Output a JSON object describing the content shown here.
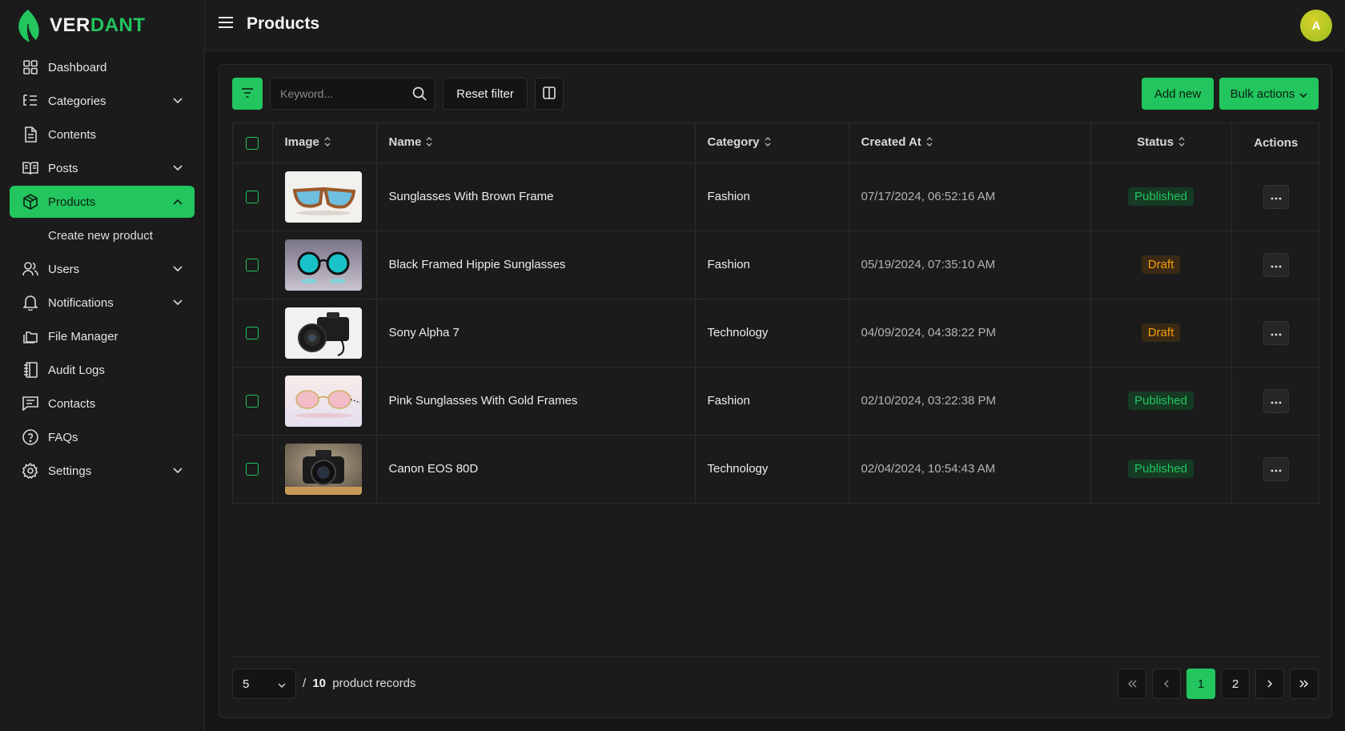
{
  "brand": {
    "part1": "VER",
    "part2": "DANT"
  },
  "header": {
    "title": "Products",
    "avatar_initial": "A"
  },
  "sidebar": {
    "items": [
      {
        "label": "Dashboard",
        "icon": "grid-icon",
        "chevron": ""
      },
      {
        "label": "Categories",
        "icon": "list-tree-icon",
        "chevron": "down"
      },
      {
        "label": "Contents",
        "icon": "document-icon",
        "chevron": ""
      },
      {
        "label": "Posts",
        "icon": "book-open-icon",
        "chevron": "down"
      },
      {
        "label": "Products",
        "icon": "box-icon",
        "chevron": "up",
        "active": true
      },
      {
        "label": "Users",
        "icon": "users-icon",
        "chevron": "down"
      },
      {
        "label": "Notifications",
        "icon": "bell-icon",
        "chevron": "down"
      },
      {
        "label": "File Manager",
        "icon": "folders-icon",
        "chevron": ""
      },
      {
        "label": "Audit Logs",
        "icon": "logs-icon",
        "chevron": ""
      },
      {
        "label": "Contacts",
        "icon": "message-icon",
        "chevron": ""
      },
      {
        "label": "FAQs",
        "icon": "help-circle-icon",
        "chevron": ""
      },
      {
        "label": "Settings",
        "icon": "gear-icon",
        "chevron": "down"
      }
    ],
    "products_sub": "Create new product"
  },
  "toolbar": {
    "search_placeholder": "Keyword...",
    "reset_label": "Reset filter",
    "add_label": "Add new",
    "bulk_label": "Bulk actions"
  },
  "table": {
    "headers": [
      "Image",
      "Name",
      "Category",
      "Created At",
      "Status",
      "Actions"
    ],
    "rows": [
      {
        "name": "Sunglasses With Brown Frame",
        "category": "Fashion",
        "created": "07/17/2024, 06:52:16 AM",
        "status": "Published",
        "image": "sunglasses-brown"
      },
      {
        "name": "Black Framed Hippie Sunglasses",
        "category": "Fashion",
        "created": "05/19/2024, 07:35:10 AM",
        "status": "Draft",
        "image": "sunglasses-round"
      },
      {
        "name": "Sony Alpha 7",
        "category": "Technology",
        "created": "04/09/2024, 04:38:22 PM",
        "status": "Draft",
        "image": "camera-sony"
      },
      {
        "name": "Pink Sunglasses With Gold Frames",
        "category": "Fashion",
        "created": "02/10/2024, 03:22:38 PM",
        "status": "Published",
        "image": "sunglasses-pink"
      },
      {
        "name": "Canon EOS 80D",
        "category": "Technology",
        "created": "02/04/2024, 10:54:43 AM",
        "status": "Published",
        "image": "camera-canon"
      }
    ]
  },
  "footer": {
    "per_page": "5",
    "separator": "/",
    "total": "10",
    "records_label": "product records",
    "pages": [
      "1",
      "2"
    ],
    "current_page": "1"
  },
  "colors": {
    "accent": "#22c55e",
    "published": "#22c55e",
    "draft": "#f59e0b",
    "background": "#161616"
  }
}
